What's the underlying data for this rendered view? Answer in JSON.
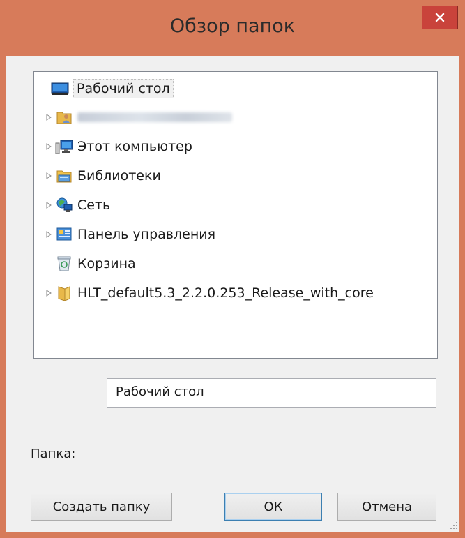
{
  "window": {
    "title": "Обзор папок"
  },
  "tree": {
    "items": [
      {
        "label": "Рабочий стол",
        "icon": "desktop-icon",
        "expandable": false,
        "selected": true
      },
      {
        "label": "",
        "icon": "user-folder-icon",
        "expandable": true,
        "blurred": true
      },
      {
        "label": "Этот компьютер",
        "icon": "computer-icon",
        "expandable": true
      },
      {
        "label": "Библиотеки",
        "icon": "libraries-icon",
        "expandable": true
      },
      {
        "label": "Сеть",
        "icon": "network-icon",
        "expandable": true
      },
      {
        "label": "Панель управления",
        "icon": "control-panel-icon",
        "expandable": true
      },
      {
        "label": "Корзина",
        "icon": "recycle-bin-icon",
        "expandable": false
      },
      {
        "label": "HLT_default5.3_2.2.0.253_Release_with_core",
        "icon": "folder-icon",
        "expandable": true
      }
    ]
  },
  "folder_field": {
    "label": "Папка:",
    "value": "Рабочий стол"
  },
  "buttons": {
    "new_folder": "Создать папку",
    "ok": "ОК",
    "cancel": "Отмена"
  },
  "colors": {
    "frame": "#d77b5a",
    "close_button": "#c9433b",
    "client": "#f0f0f0"
  }
}
